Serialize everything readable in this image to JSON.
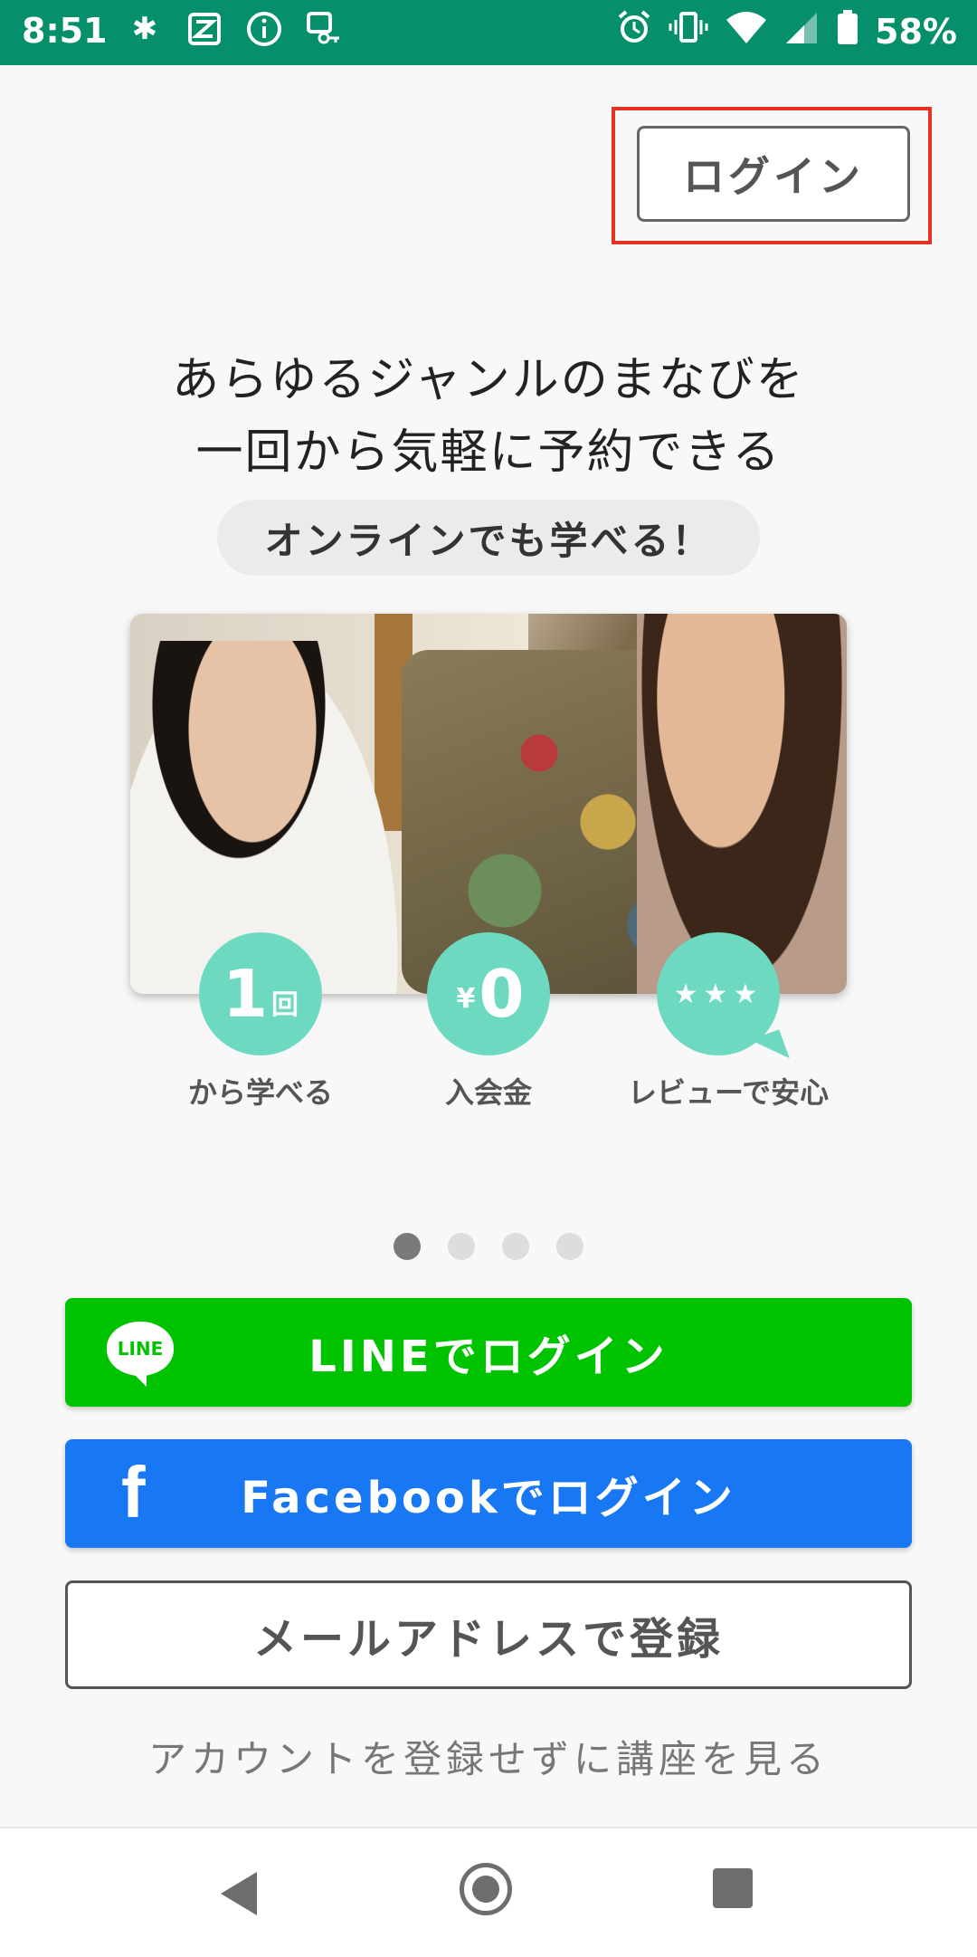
{
  "status_bar": {
    "time": "8:51",
    "battery": "58%",
    "icons": [
      "slack-icon",
      "z-app-icon",
      "info-icon",
      "ic-key-icon",
      "alarm-icon",
      "vibrate-icon",
      "wifi-icon",
      "signal-icon",
      "battery-icon"
    ]
  },
  "header": {
    "login_label": "ログイン"
  },
  "hero": {
    "line1": "あらゆるジャンルのまなびを",
    "line2": "一回から気軽に予約できる",
    "pill": "オンラインでも学べる！"
  },
  "features": [
    {
      "badge_main": "1",
      "badge_sub": "回",
      "label": "から学べる"
    },
    {
      "badge_main": "0",
      "badge_sub": "¥",
      "label": "入会金"
    },
    {
      "badge_main": "★★★",
      "label": "レビューで安心"
    }
  ],
  "carousel": {
    "pages": 4,
    "active_index": 0
  },
  "buttons": {
    "line_icon_text": "LINE",
    "line_label": "LINEでログイン",
    "facebook_icon_text": "f",
    "facebook_label": "Facebookでログイン",
    "mail_label": "メールアドレスで登録"
  },
  "browse_link": "アカウントを登録せずに講座を見る",
  "colors": {
    "status_bar": "#058f6b",
    "accent_mint": "#6ed9c1",
    "line_green": "#00c300",
    "facebook_blue": "#1877f2",
    "highlight_red": "#e53224"
  }
}
